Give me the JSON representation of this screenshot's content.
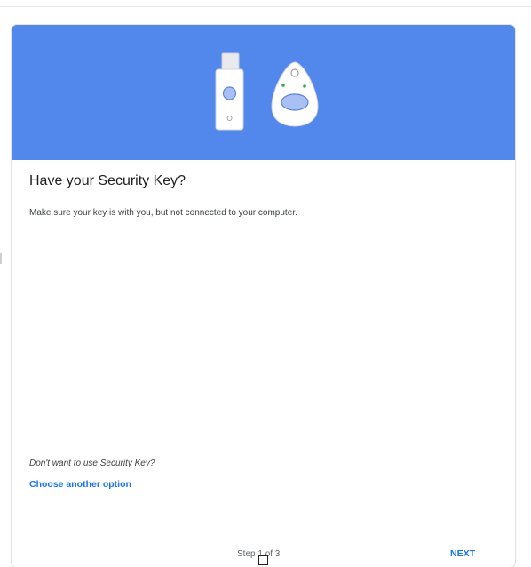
{
  "card": {
    "title": "Have your Security Key?",
    "description": "Make sure your key is with you, but not connected to your computer.",
    "alt_question": "Don't want to use Security Key?",
    "alt_link": "Choose another option",
    "step_text": "Step 1 of 3",
    "next_label": "NEXT"
  },
  "colors": {
    "hero_background": "#5288ec",
    "link": "#1a73e8"
  },
  "icons": {
    "usb_key": "usb-security-key-icon",
    "fob_key": "fob-security-key-icon"
  }
}
